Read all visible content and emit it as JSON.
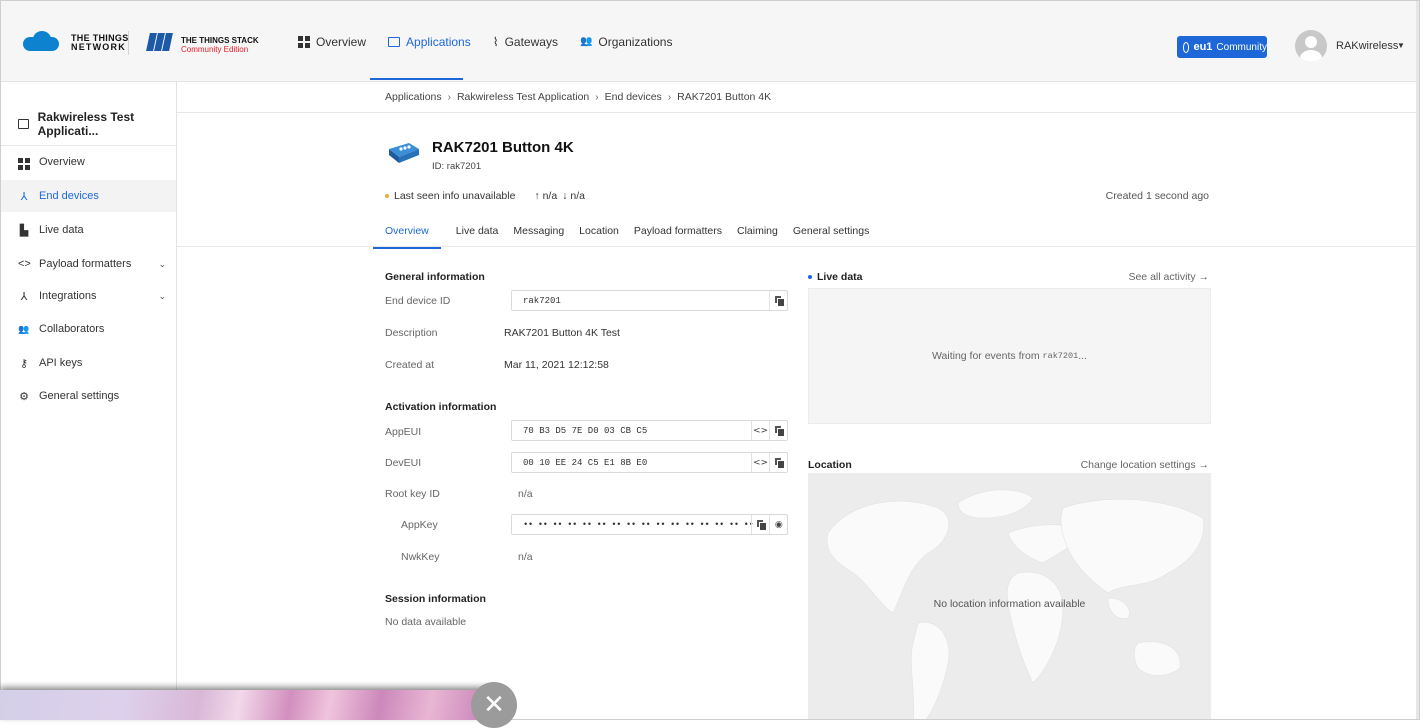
{
  "header": {
    "ttn_logo_line1": "THE THINGS",
    "ttn_logo_line2": "NETWORK",
    "stack_line1": "THE THINGS STACK",
    "stack_line2": "Community Edition",
    "nav": [
      {
        "label": "Overview",
        "icon": "overview-grid-icon",
        "active": false
      },
      {
        "label": "Applications",
        "icon": "application-box-icon",
        "active": true
      },
      {
        "label": "Gateways",
        "icon": "gateway-icon",
        "active": false
      },
      {
        "label": "Organizations",
        "icon": "organizations-icon",
        "active": false
      }
    ],
    "cluster_bold": "eu1",
    "cluster_label": "Community",
    "username": "RAKwireless",
    "accent_color": "#1d67d9"
  },
  "sidebar": {
    "title": "Rakwireless Test Applicati...",
    "items": [
      {
        "label": "Overview",
        "icon": "overview-grid-icon",
        "active": false
      },
      {
        "label": "End devices",
        "icon": "end-devices-icon",
        "active": true
      },
      {
        "label": "Live data",
        "icon": "live-data-icon",
        "active": false
      },
      {
        "label": "Payload formatters",
        "icon": "code-icon",
        "active": false,
        "expandable": true
      },
      {
        "label": "Integrations",
        "icon": "integrations-icon",
        "active": false,
        "expandable": true
      },
      {
        "label": "Collaborators",
        "icon": "collaborators-icon",
        "active": false
      },
      {
        "label": "API keys",
        "icon": "key-icon",
        "active": false
      },
      {
        "label": "General settings",
        "icon": "gear-icon",
        "active": false
      }
    ]
  },
  "breadcrumb": [
    "Applications",
    "Rakwireless Test Application",
    "End devices",
    "RAK7201 Button 4K"
  ],
  "device": {
    "name": "RAK7201 Button 4K",
    "id_label": "ID: rak7201",
    "last_seen": "Last seen info unavailable",
    "uplink": "↑ n/a",
    "downlink": "↓ n/a",
    "created": "Created 1 second ago"
  },
  "tabs": [
    "Overview",
    "Live data",
    "Messaging",
    "Location",
    "Payload formatters",
    "Claiming",
    "General settings"
  ],
  "general_info": {
    "heading": "General information",
    "end_device_id_label": "End device ID",
    "end_device_id": "rak7201",
    "description_label": "Description",
    "description": "RAK7201 Button 4K Test",
    "created_at_label": "Created at",
    "created_at": "Mar 11, 2021 12:12:58"
  },
  "activation_info": {
    "heading": "Activation information",
    "app_eui_label": "AppEUI",
    "app_eui": "70 B3 D5 7E D0 03 CB C5",
    "dev_eui_label": "DevEUI",
    "dev_eui": "00 10 EE 24 C5 E1 8B E0",
    "root_key_label": "Root key ID",
    "root_key": "n/a",
    "app_key_label": "AppKey",
    "app_key": "•• •• •• •• •• •• •• •• •• •• •• •• •• •• •• ••",
    "nwk_key_label": "NwkKey",
    "nwk_key": "n/a"
  },
  "session_info": {
    "heading": "Session information",
    "text": "No data available"
  },
  "live_data": {
    "heading": "Live data",
    "link": "See all activity →",
    "waiting_prefix": "Waiting for events from ",
    "waiting_device": "rak7201",
    "waiting_suffix": "..."
  },
  "location": {
    "heading": "Location",
    "link": "Change location settings →",
    "empty": "No location information available"
  },
  "overlay": {
    "close_icon": "close-icon"
  }
}
